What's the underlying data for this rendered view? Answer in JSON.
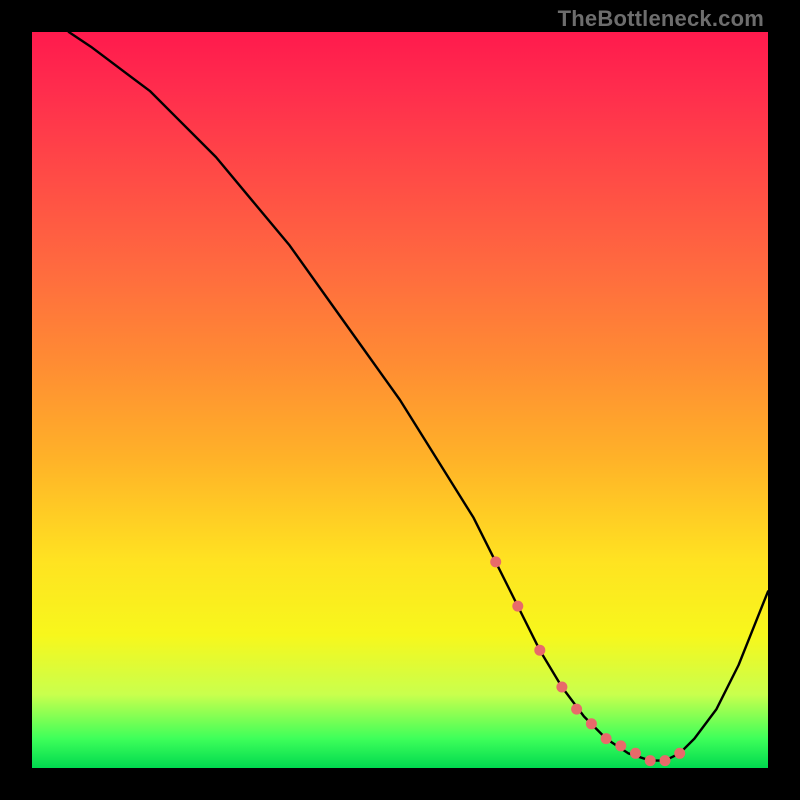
{
  "watermark_text": "TheBottleneck.com",
  "chart_data": {
    "type": "line",
    "title": "",
    "xlabel": "",
    "ylabel": "",
    "xlim": [
      0,
      100
    ],
    "ylim": [
      0,
      100
    ],
    "grid": false,
    "legend": false,
    "series": [
      {
        "name": "bottleneck-curve",
        "x": [
          5,
          8,
          12,
          16,
          20,
          25,
          30,
          35,
          40,
          45,
          50,
          55,
          60,
          63,
          66,
          69,
          72,
          75,
          78,
          81,
          84,
          86,
          88,
          90,
          93,
          96,
          100
        ],
        "values": [
          100,
          98,
          95,
          92,
          88,
          83,
          77,
          71,
          64,
          57,
          50,
          42,
          34,
          28,
          22,
          16,
          11,
          7,
          4,
          2,
          1,
          1,
          2,
          4,
          8,
          14,
          24
        ]
      }
    ],
    "markers": {
      "name": "highlight-points",
      "color": "#e86a6a",
      "x": [
        63,
        66,
        69,
        72,
        74,
        76,
        78,
        80,
        82,
        84,
        86,
        88
      ],
      "values": [
        28,
        22,
        16,
        11,
        8,
        6,
        4,
        3,
        2,
        1,
        1,
        2
      ]
    }
  }
}
